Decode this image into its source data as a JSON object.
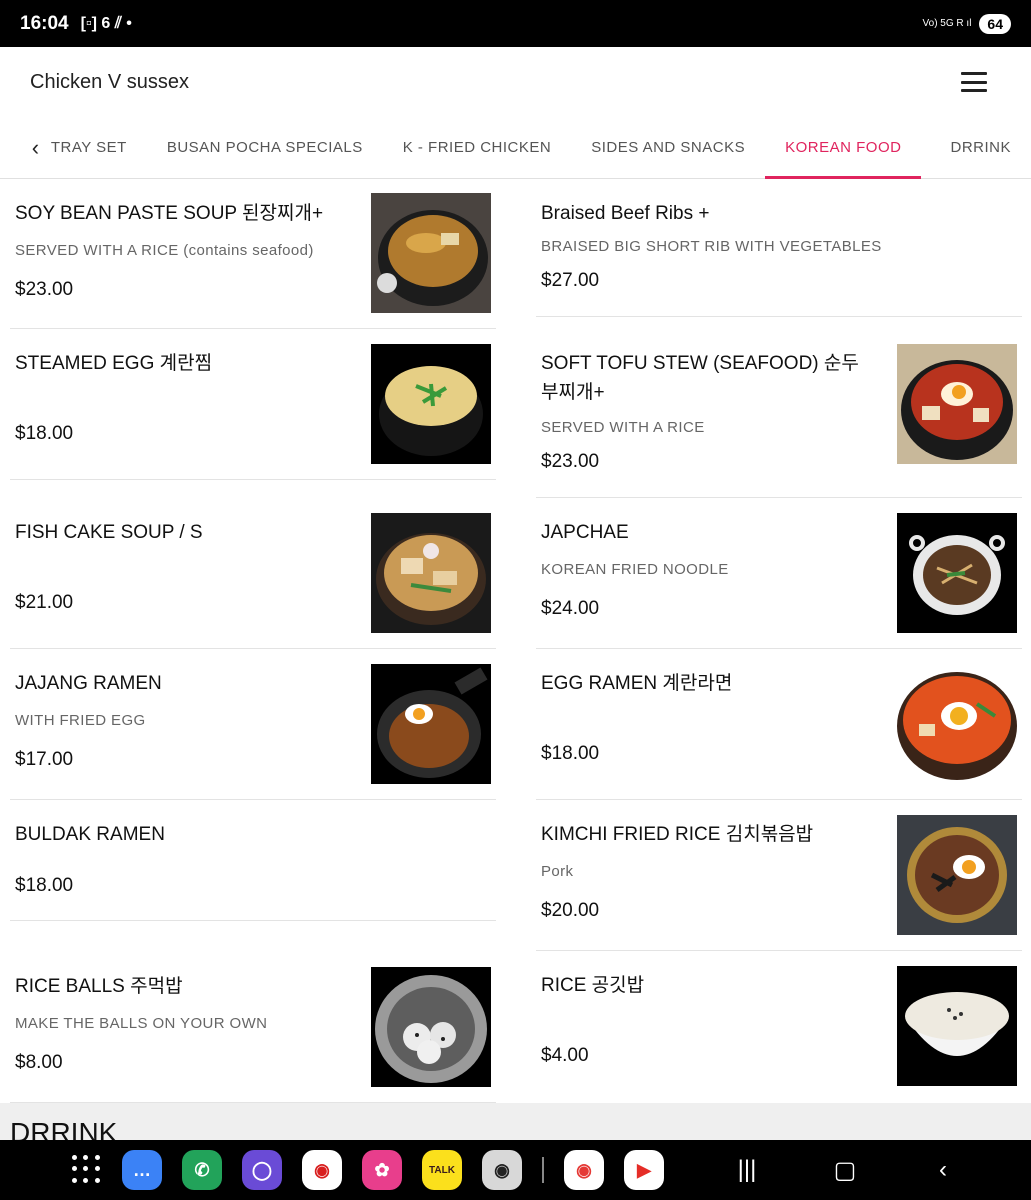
{
  "status_bar": {
    "time": "16:04",
    "indicators": "[▫] 6 ⫽ •",
    "network": "Vo) 5G R ıl",
    "battery": "64"
  },
  "header": {
    "title": "Chicken V sussex"
  },
  "tabs": [
    {
      "label": "TRAY SET",
      "active": false
    },
    {
      "label": "BUSAN POCHA SPECIALS",
      "active": false
    },
    {
      "label": "K - FRIED CHICKEN",
      "active": false
    },
    {
      "label": "SIDES AND SNACKS",
      "active": false
    },
    {
      "label": "KOREAN FOOD",
      "active": true
    },
    {
      "label": "DRRINK",
      "active": false
    }
  ],
  "items_left": [
    {
      "name": "SOY BEAN PASTE SOUP 된장찌개+",
      "desc": "SERVED WITH A RICE (contains seafood)",
      "price": "$23.00",
      "image": "soybean-soup"
    },
    {
      "name": "STEAMED EGG 계란찜",
      "desc": "",
      "price": "$18.00",
      "image": "steamed-egg"
    },
    {
      "name": "FISH CAKE SOUP / S",
      "desc": "",
      "price": "$21.00",
      "image": "fish-cake-soup"
    },
    {
      "name": "JAJANG RAMEN",
      "desc": "WITH FRIED EGG",
      "price": "$17.00",
      "image": "jajang-ramen"
    },
    {
      "name": "BULDAK RAMEN",
      "desc": "",
      "price": "$18.00",
      "image": ""
    },
    {
      "name": "RICE BALLS 주먹밥",
      "desc": "MAKE THE BALLS ON YOUR OWN",
      "price": "$8.00",
      "image": "rice-balls"
    }
  ],
  "items_right": [
    {
      "name": "Braised Beef Ribs +",
      "desc": "BRAISED BIG SHORT RIB WITH VEGETABLES",
      "price": "$27.00",
      "image": ""
    },
    {
      "name": "SOFT TOFU STEW (SEAFOOD) 순두부찌개+",
      "desc": "SERVED WITH A RICE",
      "price": "$23.00",
      "image": "tofu-stew"
    },
    {
      "name": "JAPCHAE",
      "desc": "KOREAN FRIED NOODLE",
      "price": "$24.00",
      "image": "japchae"
    },
    {
      "name": "EGG RAMEN 계란라면",
      "desc": "",
      "price": "$18.00",
      "image": "egg-ramen"
    },
    {
      "name": "KIMCHI FRIED RICE 김치볶음밥",
      "desc": "Pork",
      "price": "$20.00",
      "image": "kimchi-fried-rice"
    },
    {
      "name": "RICE 공깃밥",
      "desc": "",
      "price": "$4.00",
      "image": "rice-bowl"
    }
  ],
  "section": {
    "title": "DRRINK"
  },
  "dock": {
    "apps": [
      "apps-grid-icon",
      "messages-icon",
      "phone-icon",
      "internet-icon",
      "app-red-icon",
      "gallery-icon",
      "kakaotalk-icon",
      "camera-icon",
      "maps-icon",
      "youtube-icon"
    ],
    "kakao_label": "TALK",
    "system": [
      "recents-button",
      "home-button",
      "back-button"
    ]
  },
  "colors": {
    "accent": "#e0245e",
    "text": "#111111",
    "muted": "#666666"
  }
}
